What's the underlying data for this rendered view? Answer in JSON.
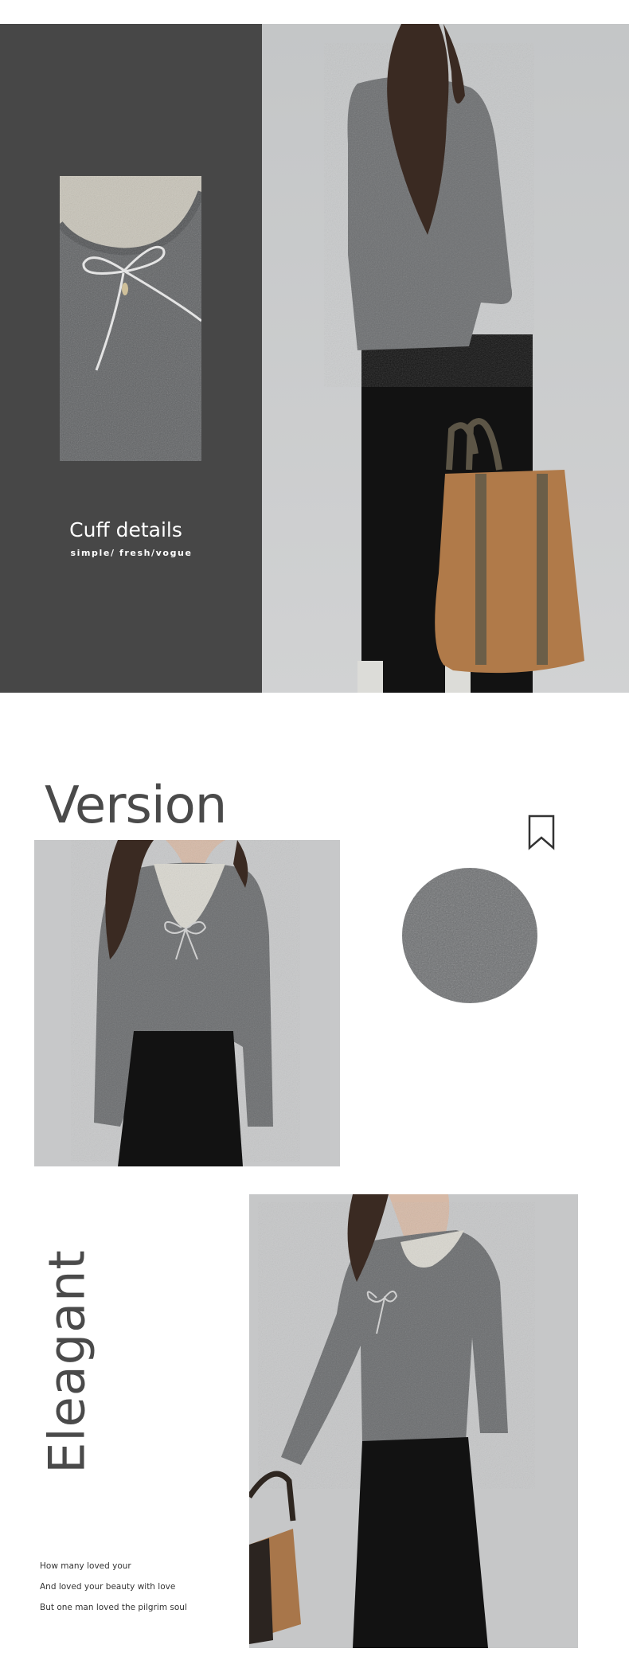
{
  "detail": {
    "title": "Cuff details",
    "subtitle": "simple/ fresh/vogue"
  },
  "version": {
    "title": "Version"
  },
  "elegant": {
    "title": "Eleagant",
    "poem": [
      "How many loved your",
      "And loved your beauty with love",
      "But one man loved the pilgrim soul"
    ]
  },
  "icons": {
    "bookmark": "bookmark-icon"
  },
  "colors": {
    "panel": "#474747",
    "sweater": "#6b6d6f",
    "skirt": "#151515",
    "bag": "#b17a4a",
    "backdrop": "#c9cbcc"
  }
}
